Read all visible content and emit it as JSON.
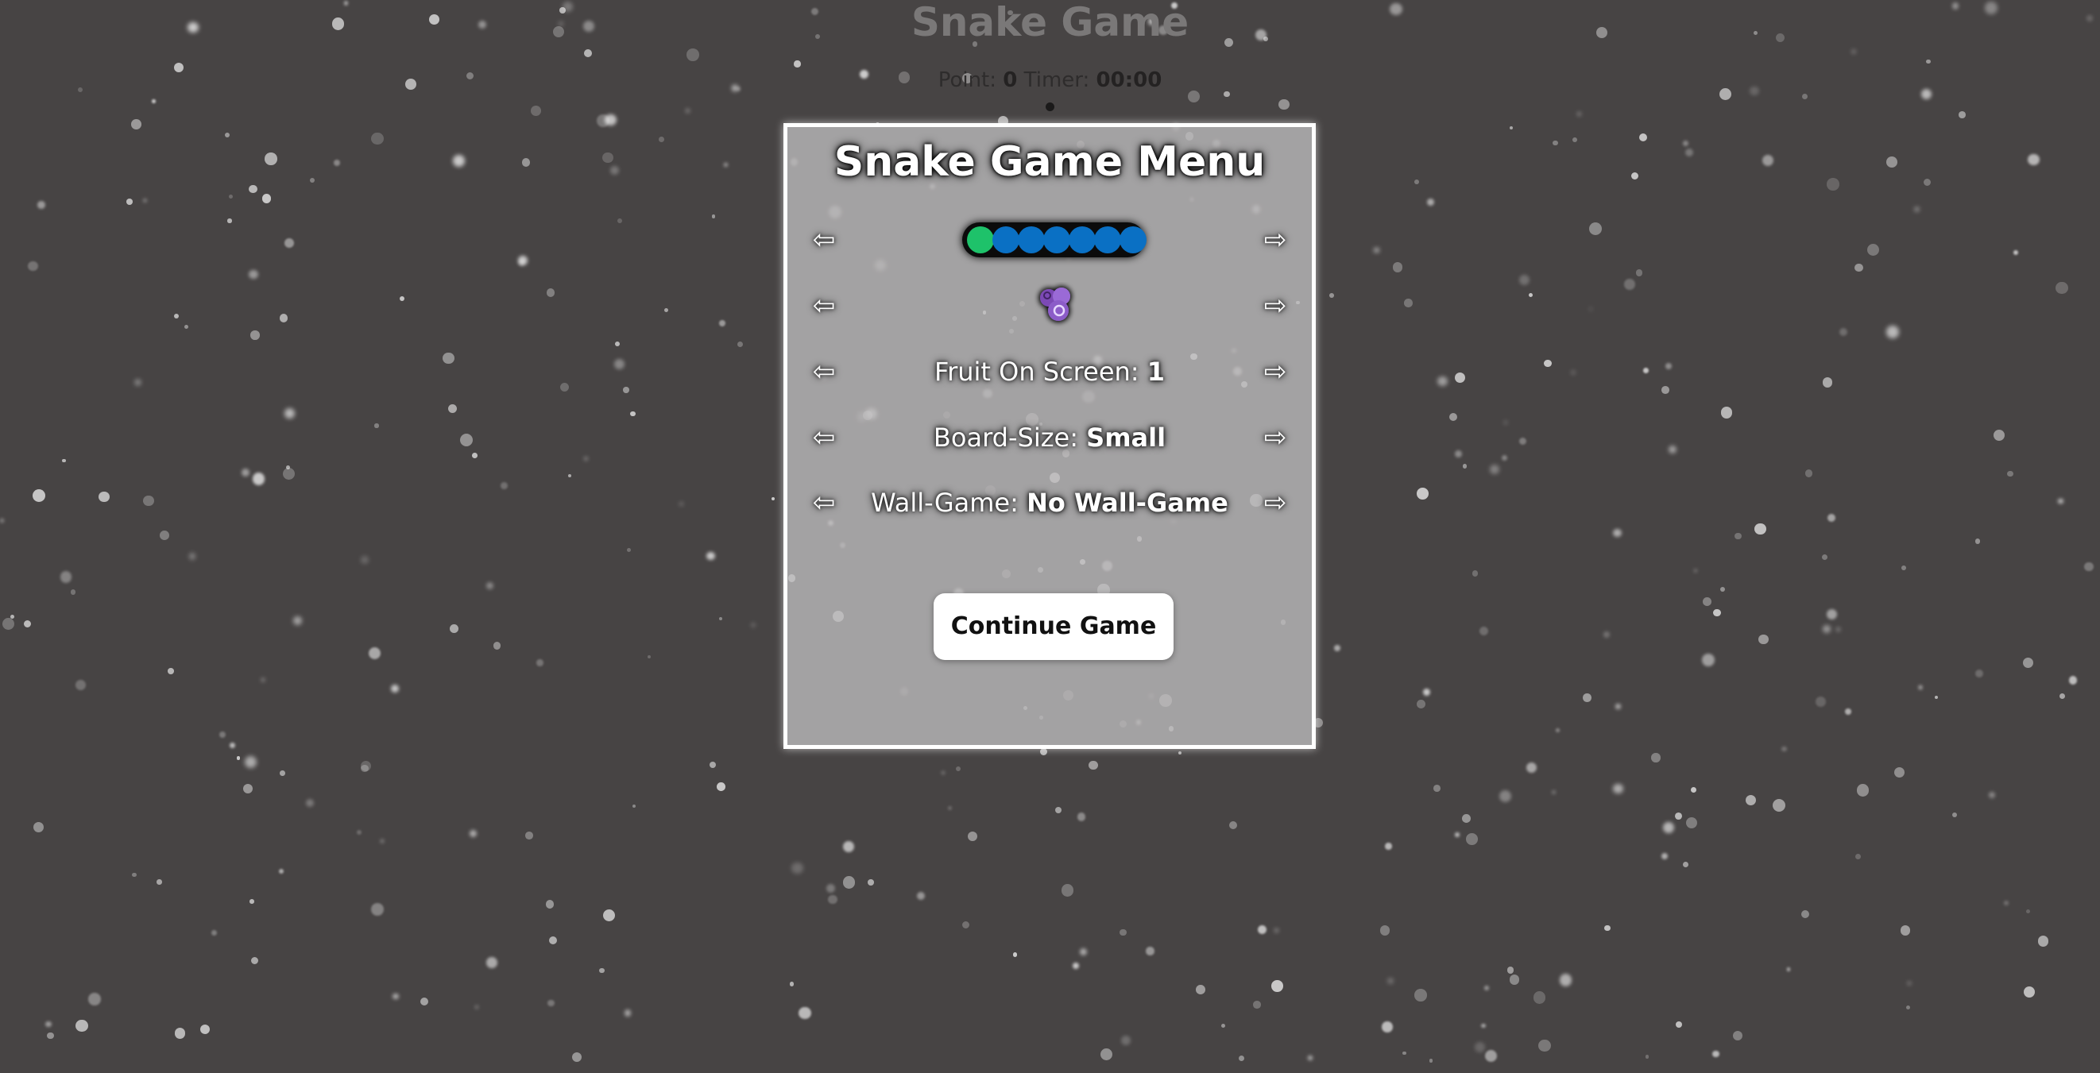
{
  "header": {
    "title": "Snake Game",
    "point_label": "Point:",
    "point_value": "0",
    "timer_label": "Timer:",
    "timer_value": "00:00"
  },
  "menu": {
    "title": "Snake Game Menu",
    "arrow_left": "⇦",
    "arrow_right": "⇨",
    "snake_skin": {
      "head_color": "#1ec26a",
      "body_color": "#0a70c4",
      "body_segments": 6
    },
    "fruit_skin": {
      "icon": "grape-icon",
      "color": "#8c5cc8"
    },
    "fruit_on_screen": {
      "label": "Fruit On Screen:",
      "value": "1"
    },
    "board_size": {
      "label": "Board-Size:",
      "value": "Small"
    },
    "wall_game": {
      "label": "Wall-Game:",
      "value": "No Wall-Game"
    },
    "continue_label": "Continue Game"
  },
  "colors": {
    "background": "#474444",
    "panel": "#bebcbe",
    "panel_border": "#ffffff"
  }
}
